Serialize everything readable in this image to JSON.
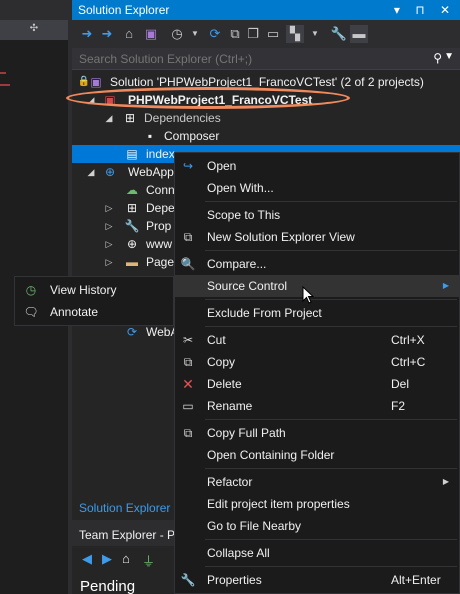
{
  "solution_explorer": {
    "title": "Solution Explorer",
    "title_controls": "▾ ⊓ ✕",
    "search_placeholder": "Search Solution Explorer (Ctrl+;)",
    "tree": {
      "solution": "Solution 'PHPWebProject1_FrancoVCTest' (2 of 2 projects)",
      "project1": "PHPWebProject1_FrancoVCTest",
      "dependencies": "Dependencies",
      "composer": "Composer",
      "index": "index.",
      "project2": "WebApp",
      "conn": "Conn",
      "depe": "Depe",
      "prop": "Prop",
      "www": "www",
      "page": "Page",
      "weba": "WebA"
    },
    "bottom_tab": "Solution Explorer"
  },
  "team_explorer": {
    "title": "Team Explorer - P",
    "pending": "Pending Chang"
  },
  "submenu": {
    "items": [
      {
        "label": "View History",
        "icon": "history-icon"
      },
      {
        "label": "Annotate",
        "icon": "annotate-icon"
      }
    ]
  },
  "context_menu": {
    "open": "Open",
    "open_with": "Open With...",
    "scope_to_this": "Scope to This",
    "new_se_view": "New Solution Explorer View",
    "compare": "Compare...",
    "source_control": "Source Control",
    "exclude": "Exclude From Project",
    "cut": "Cut",
    "cut_key": "Ctrl+X",
    "copy": "Copy",
    "copy_key": "Ctrl+C",
    "delete": "Delete",
    "delete_key": "Del",
    "rename": "Rename",
    "rename_key": "F2",
    "copy_full_path": "Copy Full Path",
    "open_folder": "Open Containing Folder",
    "refactor": "Refactor",
    "edit_props": "Edit project item properties",
    "go_to_file": "Go to File Nearby",
    "collapse_all": "Collapse All",
    "properties": "Properties",
    "properties_key": "Alt+Enter"
  },
  "colors": {
    "accent": "#007acc",
    "selection": "#0078d7",
    "highlight_oval": "#f08a5d",
    "menu_bg": "#1b1b1c"
  }
}
